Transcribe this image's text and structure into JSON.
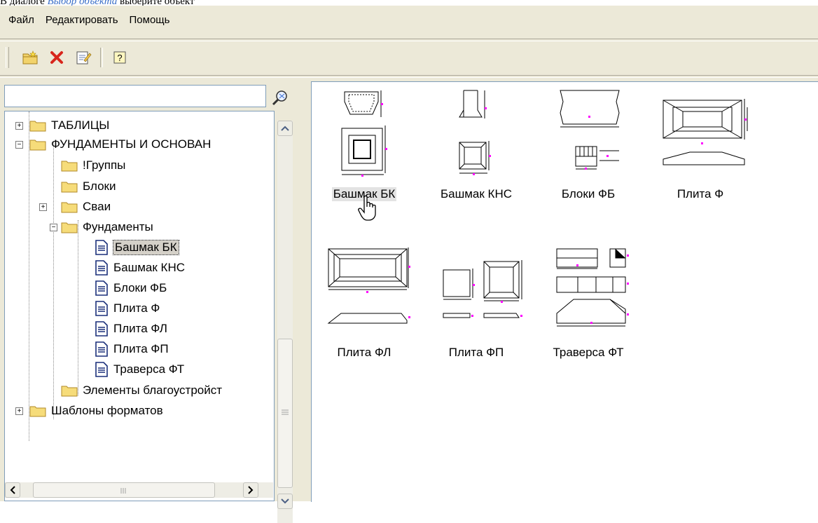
{
  "caption": {
    "prefix": "В диалоге",
    "link": "Выбор объекта",
    "suffix": "выберите объект"
  },
  "menu": [
    "Файл",
    "Редактировать",
    "Помощь"
  ],
  "toolbar": {
    "icons": [
      "new-folder-icon",
      "delete-icon",
      "edit-icon",
      "help-icon"
    ]
  },
  "search": {
    "value": "",
    "placeholder": ""
  },
  "tree": {
    "n0": "ТАБЛИЦЫ",
    "n1": "ФУНДАМЕНТЫ И ОСНОВАН",
    "n2": "!Группы",
    "n3": "Блоки",
    "n4": "Сваи",
    "n5": "Фундаменты",
    "n6": "Башмак БК",
    "n7": "Башмак КНС",
    "n8": "Блоки ФБ",
    "n9": "Плита Ф",
    "n10": "Плита ФЛ",
    "n11": "Плита ФП",
    "n12": "Траверса ФТ",
    "n13": "Элементы благоустройст",
    "n14": "Шаблоны форматов"
  },
  "items": [
    "Башмак БК",
    "Башмак КНС",
    "Блоки ФБ",
    "Плита Ф",
    "Плита ФЛ",
    "Плита ФП",
    "Траверса ФТ"
  ],
  "colors": {
    "accent": "#3b6fc8",
    "marker": "#ff00ff",
    "window": "#ece9d8"
  }
}
